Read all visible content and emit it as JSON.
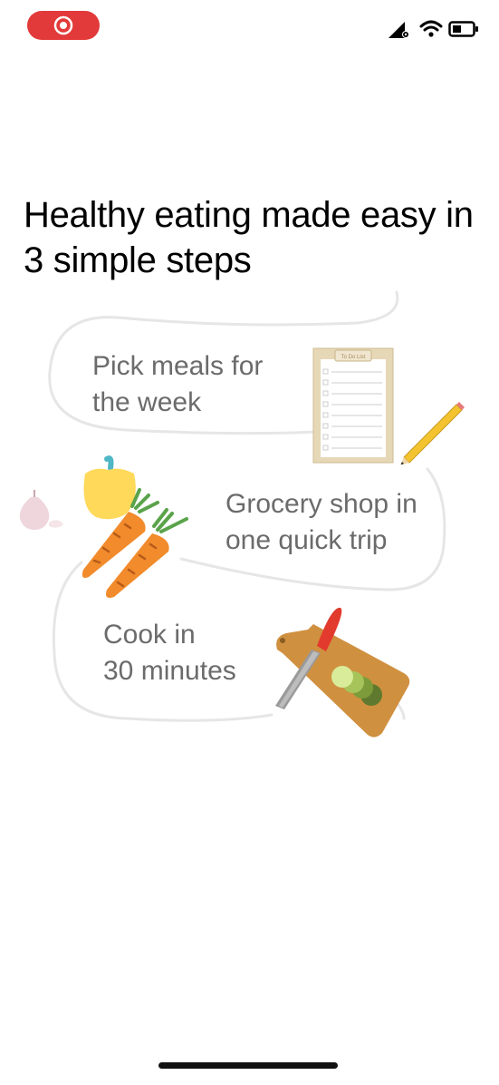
{
  "headline": "Healthy eating made easy in 3 simple steps",
  "steps": [
    {
      "text": "Pick meals for\nthe week",
      "illustration": "todo-list-clipboard-with-pencil"
    },
    {
      "text": "Grocery shop in\none quick trip",
      "illustration": "pepper-carrots-garlic"
    },
    {
      "text": "Cook in\n30 minutes",
      "illustration": "knife-cutting-board"
    }
  ],
  "clipboard_title": "To Do List",
  "status_bar": {
    "icons": [
      "record-icon",
      "signal-icon",
      "wifi-icon",
      "battery-icon"
    ]
  },
  "colors": {
    "record_pill": "#e23a3a",
    "headline": "#000000",
    "step_text": "#6b6b6b",
    "path_line": "#e6e6e6"
  }
}
